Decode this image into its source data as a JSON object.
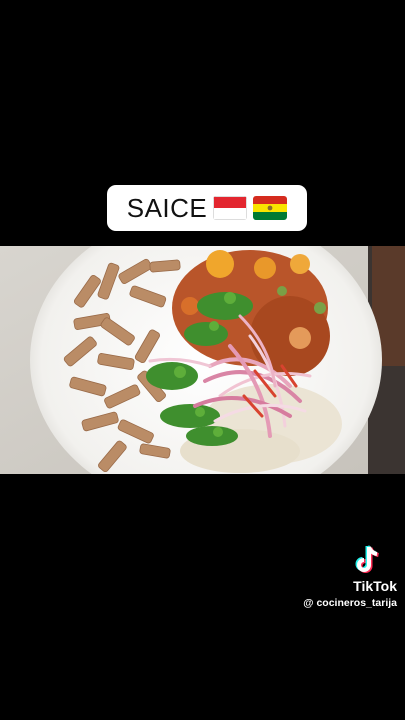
{
  "title": {
    "text": "SAICE",
    "flags": [
      "flag-indonesia-icon",
      "flag-bolivia-icon"
    ]
  },
  "watermark": {
    "brand": "TikTok",
    "handle": "@ cocineros_tarija"
  },
  "colors": {
    "background": "#000000",
    "pill": "#ffffff",
    "plate": "#f4f3f1",
    "pasta": "#b98c66",
    "stew": "#b8542a",
    "cilantro": "#3f8f2e",
    "onion": "#d98aa8",
    "rice": "#eae3d3"
  }
}
